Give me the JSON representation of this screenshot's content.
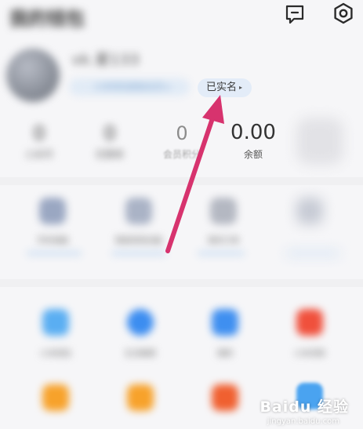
{
  "header": {
    "title": "我的钱包"
  },
  "profile": {
    "username": "vk.星133",
    "member_label": "小米钱包超级会员 ▸",
    "verified_label": "已实名"
  },
  "stats": [
    {
      "value": "0",
      "label": "小米币"
    },
    {
      "value": "0",
      "label": "优惠券"
    },
    {
      "value": "0",
      "label": "会员积分"
    },
    {
      "value": "0.00",
      "label": "余额"
    },
    {
      "value": "",
      "label": ""
    }
  ],
  "services_row": [
    {
      "label": "手机电脑",
      "sub": ""
    },
    {
      "label": "智能家居设备",
      "sub": ""
    },
    {
      "label": "我的订单",
      "sub": ""
    },
    {
      "label": "",
      "sub": ""
    }
  ],
  "apps": [
    {
      "label": "小米钱包",
      "color": "#4aa3f0"
    },
    {
      "label": "生活缴费",
      "color": "#3c8df0"
    },
    {
      "label": "理财",
      "color": "#3f8ff0"
    },
    {
      "label": "小米贷款",
      "color": "#f0503c"
    },
    {
      "label": "",
      "color": "#f7a22b"
    },
    {
      "label": "",
      "color": "#f7a22b"
    },
    {
      "label": "",
      "color": "#f06030"
    },
    {
      "label": "",
      "color": "#4aa3f0"
    }
  ],
  "watermark": {
    "brand": "Baidu 经验",
    "url": "jingyan.baidu.com"
  },
  "colors": {
    "arrow": "#d7336e",
    "accent": "#e3ecf8"
  }
}
